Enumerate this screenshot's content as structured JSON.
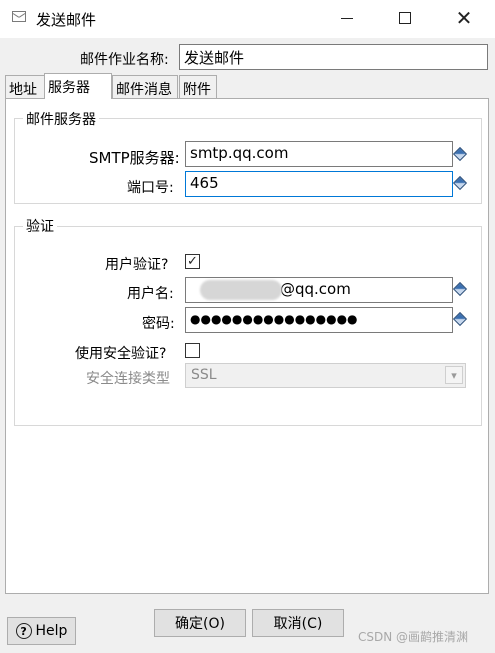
{
  "window": {
    "title": "发送邮件"
  },
  "job_name": {
    "label": "邮件作业名称:",
    "value": "发送邮件"
  },
  "tabs": [
    {
      "label": "地址",
      "active": false
    },
    {
      "label": "服务器",
      "active": true
    },
    {
      "label": "邮件消息",
      "active": false
    },
    {
      "label": "附件",
      "active": false
    }
  ],
  "server_group": {
    "title": "邮件服务器",
    "smtp": {
      "label": "SMTP服务器:",
      "value": "smtp.qq.com"
    },
    "port": {
      "label": "端口号:",
      "value": "465"
    }
  },
  "auth_group": {
    "title": "验证",
    "use_auth": {
      "label": "用户验证?",
      "checked": true,
      "mark": "✓"
    },
    "username": {
      "label": "用户名:",
      "value": "@qq.com"
    },
    "password": {
      "label": "密码:",
      "value": "●●●●●●●●●●●●●●●●"
    },
    "secure_auth": {
      "label": "使用安全验证?",
      "checked": false
    },
    "secure_type": {
      "label": "安全连接类型",
      "value": "SSL"
    }
  },
  "buttons": {
    "ok": "确定(O)",
    "cancel": "取消(C)",
    "help": "Help",
    "help_glyph": "?"
  },
  "watermark": "CSDN @画鹋推清渊",
  "icons": {
    "variable": "diamond-variable-icon",
    "mail": "mail-icon",
    "dropdown": "▾"
  },
  "colors": {
    "focus_border": "#0078d7",
    "title_bar": "#ffffff",
    "window_bg": "#f0f0f0"
  }
}
